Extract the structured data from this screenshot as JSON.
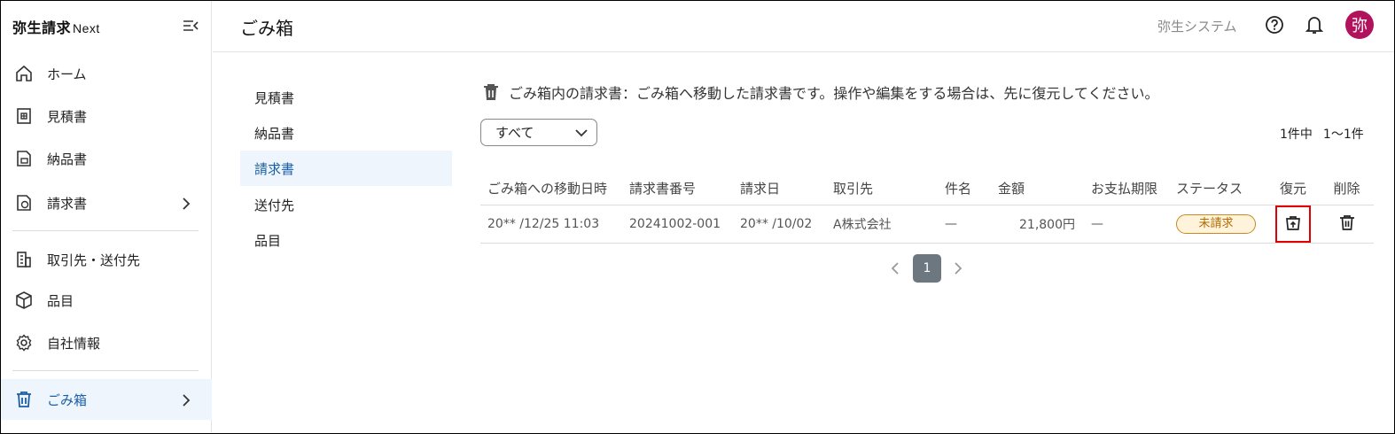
{
  "app": {
    "brand": "弥生請求",
    "brand_suffix": "Next"
  },
  "sidebar": {
    "items": [
      {
        "label": "ホーム"
      },
      {
        "label": "見積書"
      },
      {
        "label": "納品書"
      },
      {
        "label": "請求書"
      },
      {
        "label": "取引先・送付先"
      },
      {
        "label": "品目"
      },
      {
        "label": "自社情報"
      },
      {
        "label": "ごみ箱"
      }
    ]
  },
  "header": {
    "title": "ごみ箱",
    "company": "弥生システム",
    "avatar": "弥"
  },
  "subnav": {
    "items": [
      "見積書",
      "納品書",
      "請求書",
      "送付先",
      "品目"
    ]
  },
  "notice": "ごみ箱内の請求書：ごみ箱へ移動した請求書です。操作や編集をする場合は、先に復元してください。",
  "filter": {
    "value": "すべて"
  },
  "count": {
    "total": "1件中",
    "range": "1〜1件"
  },
  "table": {
    "headers": [
      "ごみ箱への移動日時",
      "請求書番号",
      "請求日",
      "取引先",
      "件名",
      "金額",
      "お支払期限",
      "ステータス",
      "復元",
      "削除"
    ],
    "rows": [
      {
        "moved_at": "20** /12/25 11:03",
        "number": "20241002-001",
        "date": "20** /10/02",
        "client": "A株式会社",
        "subject": "—",
        "amount": "21,800円",
        "due": "—",
        "status": "未請求"
      }
    ]
  },
  "pager": {
    "current": "1"
  },
  "colors": {
    "accent": "#1a5ea8",
    "active_bg": "#eef5fc",
    "avatar_bg": "#b0125b",
    "highlight": "#e00000"
  }
}
